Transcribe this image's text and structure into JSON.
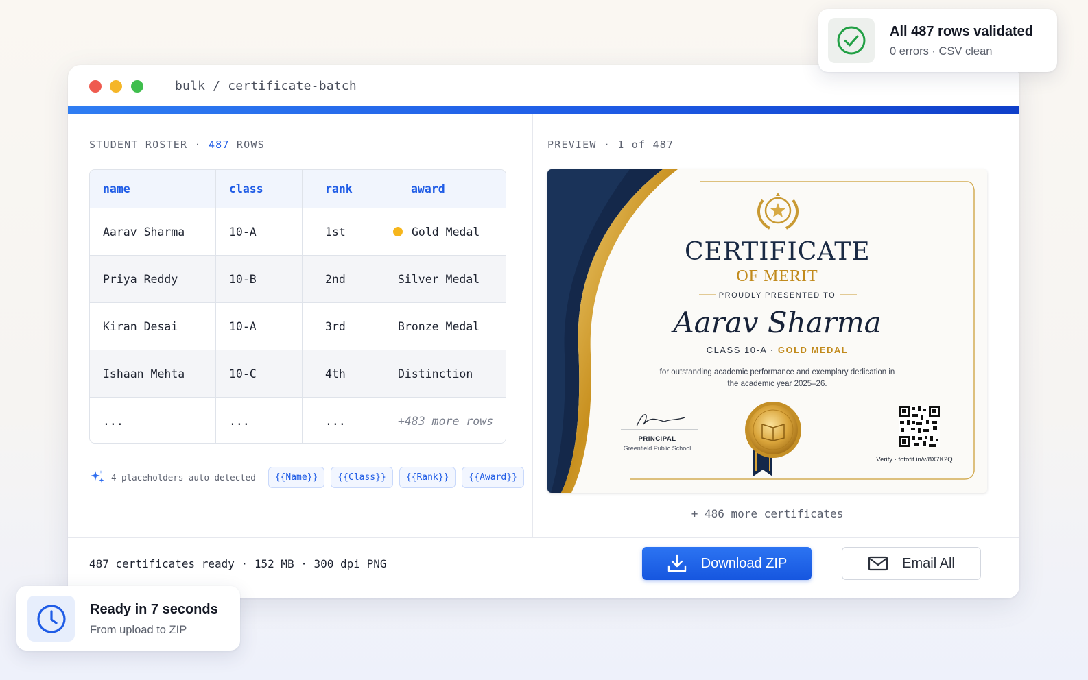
{
  "window": {
    "path": "bulk / certificate-batch"
  },
  "roster": {
    "label": "STUDENT ROSTER",
    "separator": "·",
    "count": "487",
    "unit": "ROWS",
    "columns": [
      "name",
      "class",
      "rank",
      "award"
    ],
    "rows": [
      [
        "Aarav Sharma",
        "10-A",
        "1st",
        "Gold Medal"
      ],
      [
        "Priya Reddy",
        "10-B",
        "2nd",
        "Silver Medal"
      ],
      [
        "Kiran Desai",
        "10-A",
        "3rd",
        "Bronze Medal"
      ],
      [
        "Ishaan Mehta",
        "10-C",
        "4th",
        "Distinction"
      ],
      [
        "...",
        "...",
        "...",
        "+483 more rows"
      ]
    ],
    "gold_color": "#f6b61c"
  },
  "placeholders": {
    "text": "4 placeholders auto-detected",
    "chips": [
      "{{Name}}",
      "{{Class}}",
      "{{Rank}}",
      "{{Award}}"
    ]
  },
  "preview": {
    "label": "PREVIEW · 1 of 487",
    "more": "+ 486 more certificates",
    "certificate": {
      "title": "CERTIFICATE",
      "subtitle": "OF MERIT",
      "presented": "PROUDLY PRESENTED TO",
      "name": "Aarav Sharma",
      "class_text": "CLASS 10-A",
      "separator": "·",
      "award": "GOLD MEDAL",
      "description": "for outstanding academic performance and exemplary dedication in the academic year 2025–26.",
      "signatory_role": "PRINCIPAL",
      "school": "Greenfield Public School",
      "verify": "Verify · fotofit.in/v/8X7K2Q"
    }
  },
  "footer": {
    "status": "487 certificates ready · 152 MB · 300 dpi PNG",
    "download_label": "Download ZIP",
    "email_label": "Email All"
  },
  "toasts": {
    "validated": {
      "title": "All 487 rows validated",
      "sub": "0 errors · CSV clean",
      "icon": "check-circle-icon"
    },
    "ready": {
      "title": "Ready in 7 seconds",
      "sub": "From upload to ZIP",
      "icon": "clock-icon"
    }
  },
  "colors": {
    "accent": "#1f5ce6",
    "gold": "#c18a1c",
    "navy": "#14284a",
    "success": "#22a045"
  }
}
